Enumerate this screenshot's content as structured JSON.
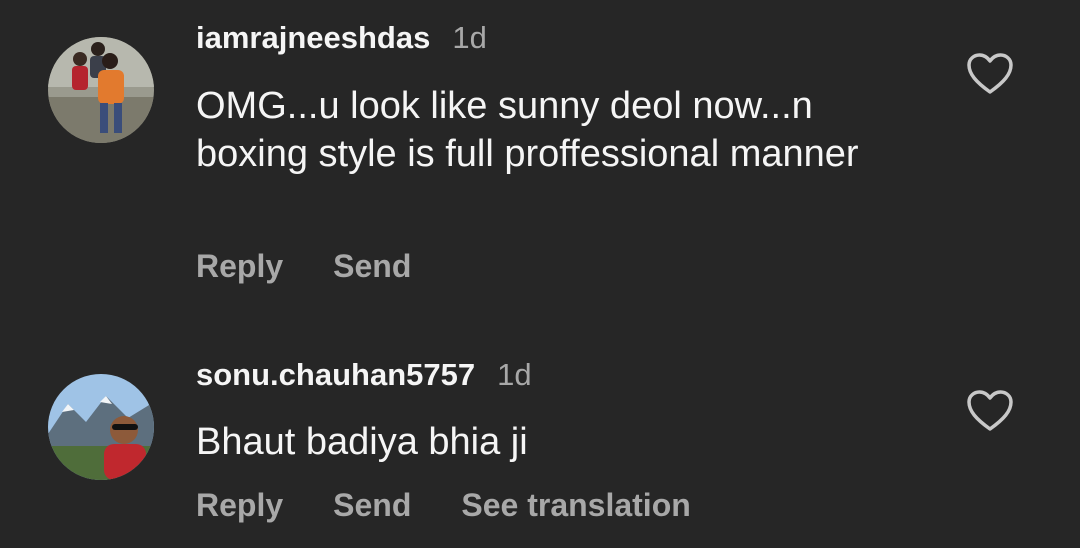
{
  "comments": [
    {
      "username": "iamrajneeshdas",
      "timestamp": "1d",
      "text": "OMG...u look like sunny deol now...n boxing style  is full  proffessional manner",
      "actions": [
        "Reply",
        "Send"
      ],
      "avatar_icon": "user-avatar",
      "like_icon": "heart-outline-icon"
    },
    {
      "username": "sonu.chauhan5757",
      "timestamp": "1d",
      "text": "Bhaut badiya bhia ji",
      "actions": [
        "Reply",
        "Send",
        "See translation"
      ],
      "avatar_icon": "user-avatar",
      "like_icon": "heart-outline-icon"
    }
  ],
  "colors": {
    "background": "#262626",
    "primary_text": "#f5f5f5",
    "secondary_text": "#a8a8a8"
  }
}
